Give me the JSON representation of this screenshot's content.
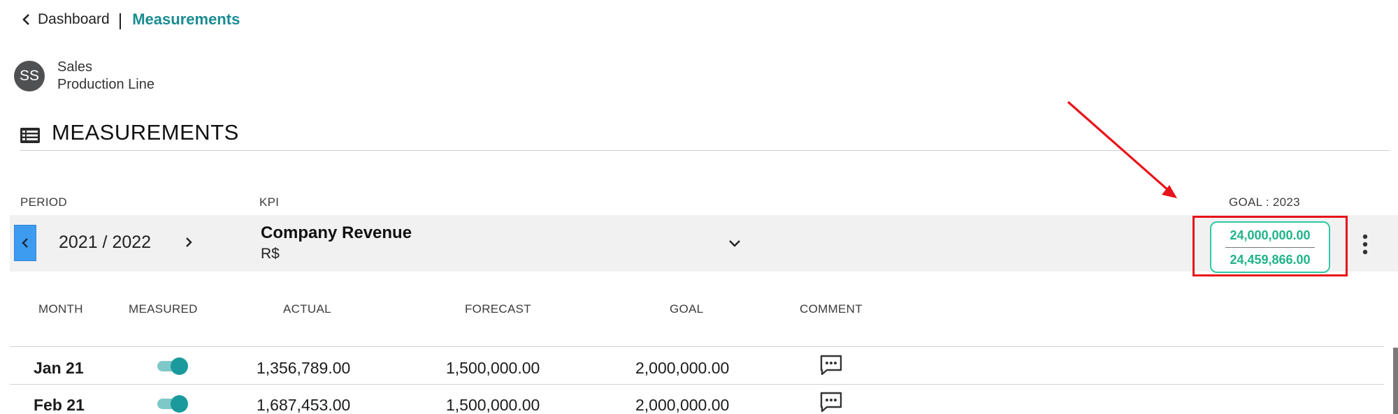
{
  "breadcrumb": {
    "back_icon": "chevron-left-icon",
    "parent": "Dashboard",
    "separator": "|",
    "current": "Measurements"
  },
  "owner": {
    "initials": "SS",
    "line1": "Sales",
    "line2": "Production Line"
  },
  "section": {
    "icon": "list-icon",
    "title": "MEASUREMENTS"
  },
  "labels": {
    "period": "PERIOD",
    "kpi": "KPI",
    "goal": "GOAL : 2023"
  },
  "period": {
    "prev_icon": "chevron-left-icon",
    "value": "2021 / 2022",
    "next_icon": "chevron-right-icon"
  },
  "kpi": {
    "name": "Company Revenue",
    "unit": "R$",
    "dropdown_icon": "chevron-down-icon"
  },
  "goal": {
    "target": "24,000,000.00",
    "achieved": "24,459,866.00",
    "more_icon": "more-vertical-icon"
  },
  "table": {
    "columns": [
      "MONTH",
      "MEASURED",
      "ACTUAL",
      "FORECAST",
      "GOAL",
      "COMMENT"
    ],
    "rows": [
      {
        "month": "Jan 21",
        "measured": true,
        "actual": "1,356,789.00",
        "forecast": "1,500,000.00",
        "goal": "2,000,000.00",
        "comment_icon": "comment-icon"
      },
      {
        "month": "Feb 21",
        "measured": true,
        "actual": "1,687,453.00",
        "forecast": "1,500,000.00",
        "goal": "2,000,000.00",
        "comment_icon": "comment-icon"
      }
    ]
  },
  "colors": {
    "accent": "#1a8c92",
    "primary_blue": "#3d9bf0",
    "goal_green": "#1fb389",
    "highlight_red": "#e8141a",
    "toggle_on": "#1a9a9c"
  }
}
